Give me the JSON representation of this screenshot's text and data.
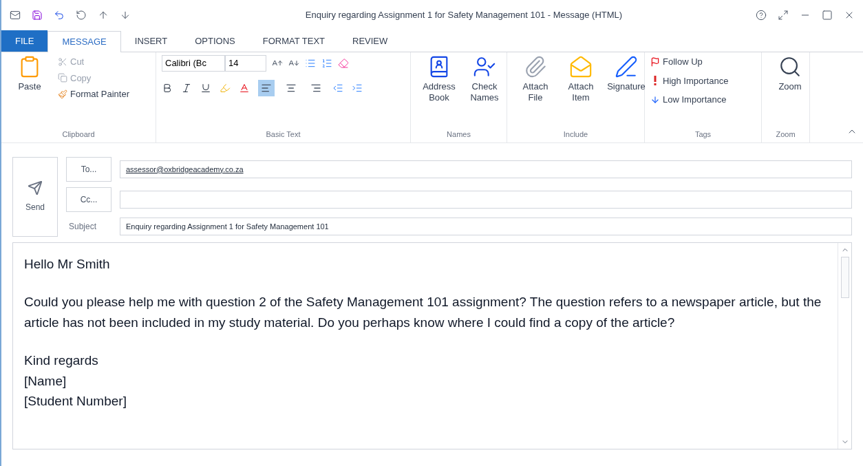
{
  "window": {
    "title": "Enquiry regarding Assignment 1 for Safety Management 101 - Message (HTML)"
  },
  "tabs": [
    {
      "label": "FILE",
      "kind": "file",
      "selected": false
    },
    {
      "label": "MESSAGE",
      "kind": "tab",
      "selected": true
    },
    {
      "label": "INSERT",
      "kind": "tab",
      "selected": false
    },
    {
      "label": "OPTIONS",
      "kind": "tab",
      "selected": false
    },
    {
      "label": "FORMAT TEXT",
      "kind": "tab",
      "selected": false
    },
    {
      "label": "REVIEW",
      "kind": "tab",
      "selected": false
    }
  ],
  "ribbon": {
    "clipboard": {
      "label": "Clipboard",
      "paste": "Paste",
      "items": [
        {
          "label": "Cut",
          "disabled": true
        },
        {
          "label": "Copy",
          "disabled": true
        },
        {
          "label": "Format Painter",
          "disabled": false
        }
      ]
    },
    "basic_text": {
      "label": "Basic Text",
      "font": "Calibri (Bc",
      "size": "14",
      "alignments": [
        {
          "selected": true
        },
        {
          "selected": false
        },
        {
          "selected": false
        }
      ]
    },
    "names": {
      "label": "Names",
      "buttons": [
        "Address Book",
        "Check Names"
      ]
    },
    "include": {
      "label": "Include",
      "buttons": [
        "Attach File",
        "Attach Item",
        "Signature"
      ]
    },
    "tags": {
      "label": "Tags",
      "items": [
        "Follow Up",
        "High Importance",
        "Low Importance"
      ]
    },
    "zoom": {
      "label": "Zoom",
      "button": "Zoom"
    }
  },
  "header": {
    "send": "Send",
    "to_button": "To...",
    "to_value": "assessor@oxbridgeacademy.co.za",
    "cc_button": "Cc...",
    "subject_label": "Subject",
    "subject_value": "Enquiry regarding Assignment 1 for Safety Management 101"
  },
  "body": {
    "paragraphs": [
      [
        "Hello Mr Smith"
      ],
      [
        "Could you please help me with question 2 of the Safety Management 101 assignment? The question refers to a newspaper article, but the article has not been included in my study material. Do you perhaps know where I could find a copy of the article?"
      ],
      [
        "Kind regards",
        "[Name]",
        "[Student Number]"
      ]
    ]
  }
}
